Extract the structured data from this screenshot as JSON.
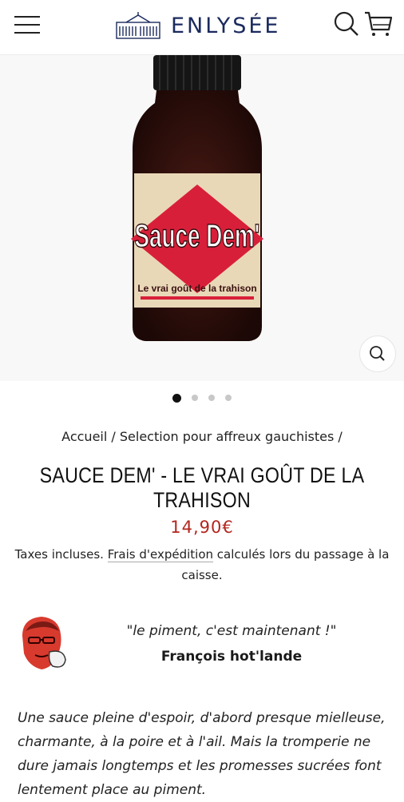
{
  "header": {
    "brand_name": "ENLYSÉE",
    "icons": [
      "hamburger-menu-icon",
      "building-logo-icon",
      "search-icon",
      "cart-icon"
    ]
  },
  "product_image": {
    "label_main": "Sauce Dem'",
    "label_sub": "Le vrai goût de la trahison",
    "carousel": {
      "count": 4,
      "active_index": 0
    }
  },
  "breadcrumb": {
    "home": "Accueil",
    "sep1": "/",
    "collection": "Selection pour affreux gauchistes",
    "sep2": "/"
  },
  "product": {
    "title": "SAUCE DEM' - LE VRAI GOÛT DE LA TRAHISON",
    "price": "14,90€",
    "tax_prefix": "Taxes incluses.",
    "shipping_link": "Frais d'expédition",
    "tax_suffix": "calculés lors du passage à la caisse."
  },
  "quote": {
    "text": "\"le piment, c'est maintenant !\"",
    "author": "François hot'lande"
  },
  "description": {
    "line1": "Une sauce pleine d'espoir, d'abord presque mielleuse,",
    "line2": "charmante, à la poire et à l'ail. Mais la tromperie ne",
    "line3": "dure jamais longtemps et les promesses sucrées font",
    "line4": "lentement place au piment."
  },
  "colors": {
    "brand": "#1b2a5e",
    "price": "#b3261e",
    "label_red": "#d81f3a",
    "label_beige": "#e9d8b8"
  }
}
